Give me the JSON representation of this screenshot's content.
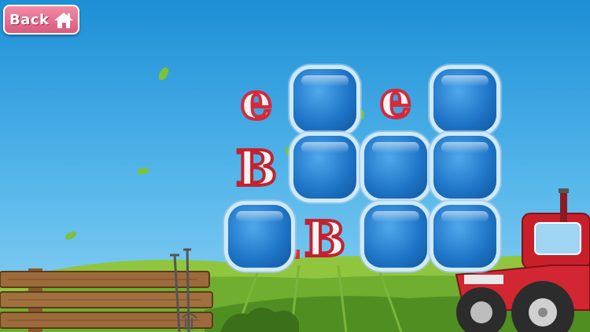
{
  "toolbar": {
    "back_label": "Back"
  },
  "board": {
    "cards": [
      {
        "state": "revealed",
        "face": "e"
      },
      {
        "state": "hidden",
        "face": ""
      },
      {
        "state": "revealed",
        "face": "e"
      },
      {
        "state": "hidden",
        "face": ""
      },
      {
        "state": "revealed",
        "face": "B"
      },
      {
        "state": "hidden",
        "face": ""
      },
      {
        "state": "hidden",
        "face": ""
      },
      {
        "state": "hidden",
        "face": ""
      },
      {
        "state": "hidden",
        "face": ""
      },
      {
        "state": "revealed",
        "face": "B"
      },
      {
        "state": "hidden",
        "face": ""
      },
      {
        "state": "hidden",
        "face": ""
      }
    ]
  },
  "icons": {
    "back": "home-icon"
  },
  "colors": {
    "sky": "#3aa6e4",
    "card_blue": "#1d73c5",
    "letter_red": "#d42a3c",
    "button_pink": "#e56d90"
  }
}
